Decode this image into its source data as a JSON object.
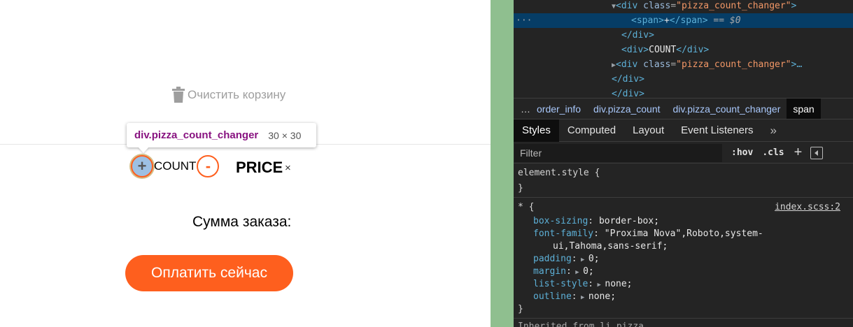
{
  "app": {
    "clear_cart_label": "Очистить корзину",
    "tooltip": {
      "selector": "div.pizza_count_changer",
      "size": "30 × 30"
    },
    "counter": {
      "plus": "+",
      "count": "COUNT",
      "minus": "-"
    },
    "price": "PRICE",
    "remove": "×",
    "total_label": "Сумма заказа:",
    "pay_button": "Оплатить сейчас",
    "accent_color": "#fe5f1e"
  },
  "devtools": {
    "dom": {
      "l1": {
        "tag_open": "<div",
        "attr": "class",
        "value": "\"pizza_count_changer\"",
        "tag_close": ">"
      },
      "l2": {
        "dots": "···",
        "span_open": "<span>",
        "text": "+",
        "span_close": "</span>",
        "eq": "==",
        "dollar": "$0"
      },
      "l3": {
        "close": "</div>"
      },
      "l4": {
        "open": "<div>",
        "text": "COUNT",
        "close": "</div>"
      },
      "l5": {
        "tag_open": "<div",
        "attr": "class",
        "value": "\"pizza_count_changer\"",
        "tag_close": ">…"
      },
      "l6": {
        "close": "</div>"
      },
      "l7": {
        "close": "</div>"
      }
    },
    "breadcrumbs": [
      "…",
      "order_info",
      "div.pizza_count",
      "div.pizza_count_changer",
      "span"
    ],
    "tabs": [
      "Styles",
      "Computed",
      "Layout",
      "Event Listeners",
      "»"
    ],
    "filter_placeholder": "Filter",
    "hov": ":hov",
    "cls": ".cls",
    "plus": "+",
    "rules": {
      "element_style": {
        "selector": "element.style {",
        "close": "}"
      },
      "universal": {
        "selector": "* {",
        "source": "index.scss:2",
        "close": "}",
        "declarations": [
          {
            "prop": "box-sizing",
            "value": "border-box;"
          },
          {
            "prop": "font-family",
            "value": "\"Proxima Nova\",Roboto,system-"
          },
          {
            "prop": "",
            "value": "ui,Tahoma,sans-serif;"
          },
          {
            "prop": "padding",
            "value": "0;"
          },
          {
            "prop": "margin",
            "value": "0;"
          },
          {
            "prop": "list-style",
            "value": "none;"
          },
          {
            "prop": "outline",
            "value": "none;"
          }
        ]
      },
      "inherited_partial": "Inherited from li.pizza..."
    }
  }
}
